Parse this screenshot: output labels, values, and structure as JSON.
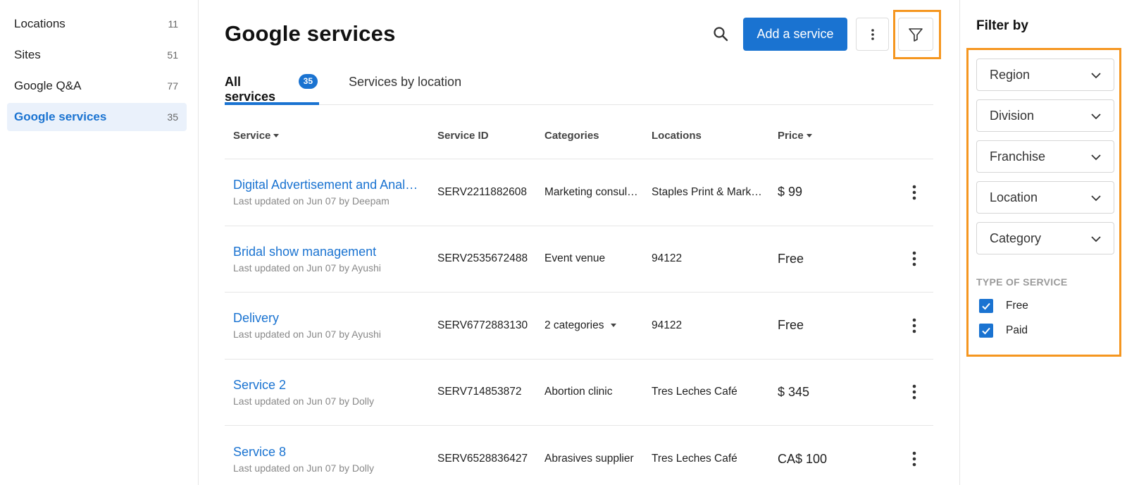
{
  "sidebar": {
    "items": [
      {
        "label": "Locations",
        "count": "11"
      },
      {
        "label": "Sites",
        "count": "51"
      },
      {
        "label": "Google Q&A",
        "count": "77"
      },
      {
        "label": "Google services",
        "count": "35"
      }
    ]
  },
  "header": {
    "title": "Google services",
    "add_label": "Add a service",
    "search_icon": "search-icon",
    "more_icon": "more-vert-icon",
    "filter_icon": "filter-icon"
  },
  "tabs": [
    {
      "label": "All services",
      "badge": "35"
    },
    {
      "label": "Services by location"
    }
  ],
  "table": {
    "columns": [
      "Service",
      "Service ID",
      "Categories",
      "Locations",
      "Price"
    ],
    "rows": [
      {
        "name": "Digital Advertisement and Analytics",
        "updated": "Last updated on Jun 07 by Deepam",
        "id": "SERV2211882608",
        "category": "Marketing consultant",
        "location": "Staples Print & Marketing",
        "price": "$ 99"
      },
      {
        "name": "Bridal show management",
        "updated": "Last updated on Jun 07 by Ayushi",
        "id": "SERV2535672488",
        "category": "Event venue",
        "location": "94122",
        "price": "Free"
      },
      {
        "name": "Delivery",
        "updated": "Last updated on Jun 07 by Ayushi",
        "id": "SERV6772883130",
        "category": "2 categories",
        "location": "94122",
        "price": "Free"
      },
      {
        "name": "Service 2",
        "updated": "Last updated on Jun 07 by Dolly",
        "id": "SERV714853872",
        "category": "Abortion clinic",
        "location": "Tres Leches Café",
        "price": "$ 345"
      },
      {
        "name": "Service 8",
        "updated": "Last updated on Jun 07 by Dolly",
        "id": "SERV6528836427",
        "category": "Abrasives supplier",
        "location": "Tres Leches Café",
        "price": "CA$ 100"
      }
    ]
  },
  "filter": {
    "title": "Filter by",
    "dropdowns": [
      "Region",
      "Division",
      "Franchise",
      "Location",
      "Category"
    ],
    "section_label": "TYPE OF SERVICE",
    "checks": [
      {
        "label": "Free",
        "checked": true
      },
      {
        "label": "Paid",
        "checked": true
      }
    ]
  },
  "colors": {
    "accent": "#1a73d1",
    "highlight": "#f5961f"
  }
}
